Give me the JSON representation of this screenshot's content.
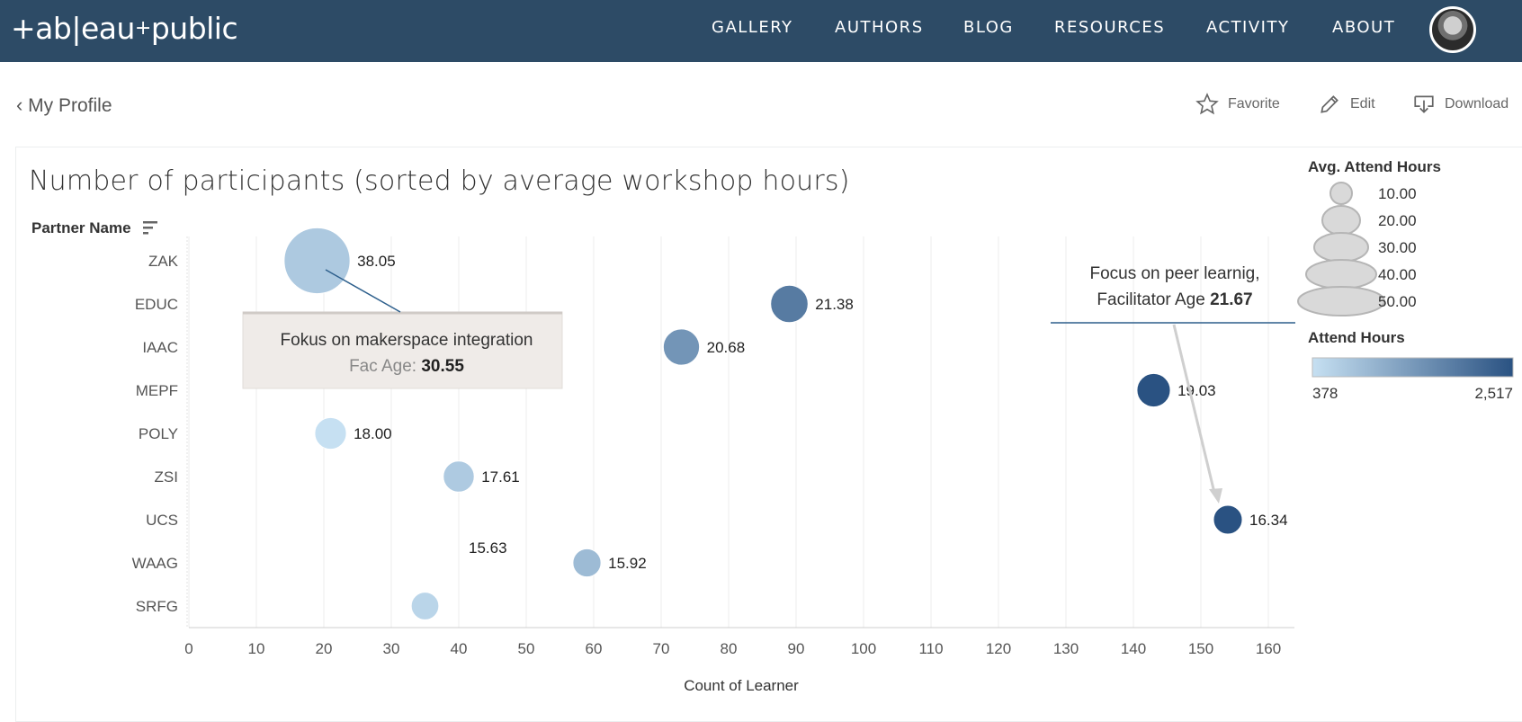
{
  "header": {
    "logo": "+ab|eau+public",
    "nav": [
      "GALLERY",
      "AUTHORS",
      "BLOG",
      "RESOURCES",
      "ACTIVITY",
      "ABOUT"
    ]
  },
  "toolbar": {
    "back_label": "My Profile",
    "favorite_label": "Favorite",
    "edit_label": "Edit",
    "download_label": "Download"
  },
  "colors": {
    "topbar": "#2d4b66",
    "bubble_light": "#c6e0f2",
    "bubble_dark": "#2a5282"
  },
  "chart_data": {
    "type": "scatter",
    "title": "Number of participants (sorted by average workshop hours)",
    "ylabel": "Partner Name",
    "xlabel": "Count of Learner",
    "xlim": [
      0,
      165
    ],
    "xticks": [
      0,
      10,
      20,
      30,
      40,
      50,
      60,
      70,
      80,
      90,
      100,
      110,
      120,
      130,
      140,
      150,
      160
    ],
    "grid": true,
    "categories": [
      "ZAK",
      "EDUC",
      "IAAC",
      "MEPF",
      "POLY",
      "ZSI",
      "UCS",
      "WAAG",
      "SRFG"
    ],
    "points": [
      {
        "partner": "ZAK",
        "count": 19,
        "avg_hours": 38.05,
        "attend_hours": 723,
        "label": "38.05"
      },
      {
        "partner": "EDUC",
        "count": 89,
        "avg_hours": 21.38,
        "attend_hours": 1903,
        "label": "21.38"
      },
      {
        "partner": "IAAC",
        "count": 73,
        "avg_hours": 20.68,
        "attend_hours": 1510,
        "label": "20.68"
      },
      {
        "partner": "MEPF",
        "count": 143,
        "avg_hours": 19.03,
        "attend_hours": 2517,
        "label": "19.03"
      },
      {
        "partner": "POLY",
        "count": 21,
        "avg_hours": 18.0,
        "attend_hours": 378,
        "label": "18.00"
      },
      {
        "partner": "ZSI",
        "count": 40,
        "avg_hours": 17.61,
        "attend_hours": 704,
        "label": "17.61"
      },
      {
        "partner": "UCS",
        "count": 154,
        "avg_hours": 16.34,
        "attend_hours": 2517,
        "label": "16.34"
      },
      {
        "partner": "WAAG",
        "count": 59,
        "avg_hours": 15.92,
        "attend_hours": 939,
        "label": "15.92"
      },
      {
        "partner": "SRFG",
        "count": 35,
        "avg_hours": 15.63,
        "attend_hours": 547,
        "label": "15.63"
      }
    ],
    "annotations": [
      {
        "text": "Fokus on makerspace integration",
        "sub_label": "Fac Age:",
        "sub_value": "30.55"
      },
      {
        "text": "Focus on peer learnig,",
        "sub_label": "Facilitator Age",
        "sub_value": "21.67"
      }
    ],
    "size_legend": {
      "title": "Avg. Attend Hours",
      "values": [
        "10.00",
        "20.00",
        "30.00",
        "40.00",
        "50.00"
      ]
    },
    "color_legend": {
      "title": "Attend Hours",
      "min_label": "378",
      "max_label": "2,517",
      "min": 378,
      "max": 2517
    }
  }
}
